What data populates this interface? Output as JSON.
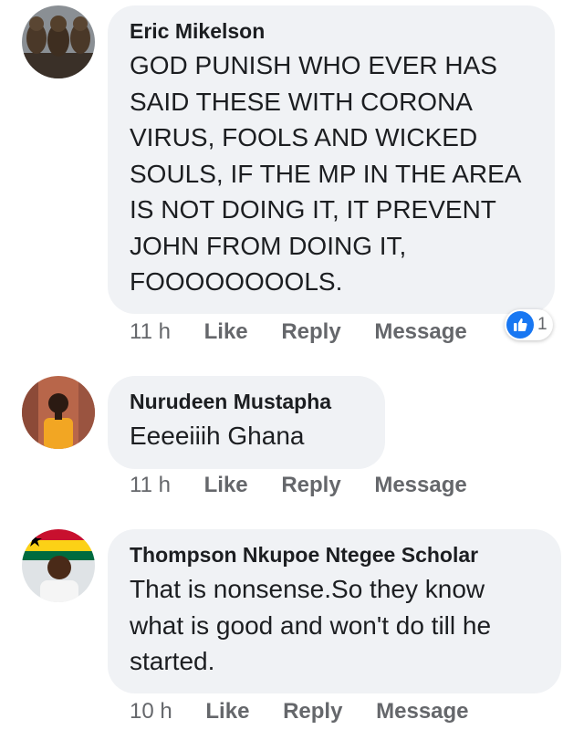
{
  "comments": [
    {
      "author": "Eric Mikelson",
      "text": "GOD PUNISH WHO EVER HAS SAID THESE WITH CORONA VIRUS, FOOLS AND WICKED SOULS, IF THE MP IN THE AREA IS NOT DOING IT, IT PREVENT JOHN FROM DOING IT, FOOOOOOOOLS.",
      "time": "11 h",
      "like_label": "Like",
      "reply_label": "Reply",
      "message_label": "Message",
      "reaction_count": "1",
      "reaction_icon": "thumbs-up-icon"
    },
    {
      "author": "Nurudeen Mustapha",
      "text": "Eeeeiiih Ghana",
      "time": "11 h",
      "like_label": "Like",
      "reply_label": "Reply",
      "message_label": "Message"
    },
    {
      "author": "Thompson Nkupoe Ntegee Scholar",
      "text": "That is nonsense.So they know what is good and won't do till he started.",
      "time": "10 h",
      "like_label": "Like",
      "reply_label": "Reply",
      "message_label": "Message"
    }
  ],
  "colors": {
    "bubble": "#f0f2f5",
    "secondary_text": "#65676b",
    "like_blue": "#1877f2"
  }
}
